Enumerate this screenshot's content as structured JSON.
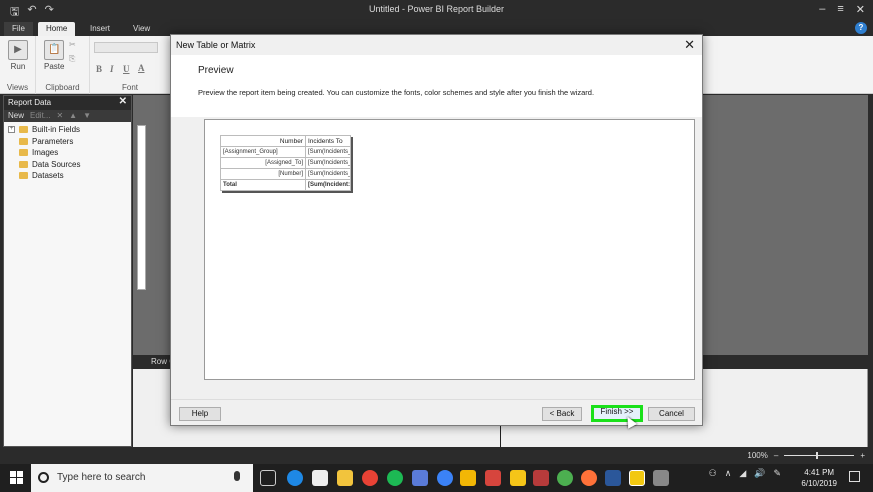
{
  "app": {
    "window_title": "Untitled - Power BI Report Builder",
    "ribbon_tabs": [
      {
        "label": "File"
      },
      {
        "label": "Home"
      },
      {
        "label": "Insert"
      },
      {
        "label": "View"
      }
    ],
    "ribbon": {
      "run_label": "Run",
      "paste_label": "Paste",
      "group_views": "Views",
      "group_clipboard": "Clipboard",
      "group_font": "Font",
      "bold": "B",
      "italic": "I",
      "underline": "U",
      "font_color": "A"
    },
    "help_icon_text": "?"
  },
  "report_data": {
    "title": "Report Data",
    "toolbar": {
      "new_label": "New",
      "edit_label": "Edit..."
    },
    "items": [
      {
        "label": "Built-in Fields"
      },
      {
        "label": "Parameters"
      },
      {
        "label": "Images"
      },
      {
        "label": "Data Sources"
      },
      {
        "label": "Datasets"
      }
    ]
  },
  "design": {
    "row_groups_label": "Row G"
  },
  "dialog": {
    "title": "New Table or Matrix",
    "heading": "Preview",
    "description": "Preview the report item being created. You can customize the fonts, color schemes and style after you finish the wizard.",
    "buttons": {
      "help": "Help",
      "back": "< Back",
      "finish": "Finish >>",
      "cancel": "Cancel"
    },
    "preview_matrix": {
      "header": [
        "Number",
        "Incidents To"
      ],
      "rows": [
        [
          "[Assignment_Group]",
          "[Sum(Incidents_"
        ],
        [
          "[Assigned_To]",
          "[Sum(Incidents_"
        ],
        [
          "[Number]",
          "[Sum(Incidents_"
        ]
      ],
      "total": [
        "Total",
        "[Sum(Incident:"
      ]
    }
  },
  "statusbar": {
    "zoom_label": "100%"
  },
  "taskbar": {
    "search_placeholder": "Type here to search",
    "time": "4:41 PM",
    "date": "6/10/2019"
  },
  "colors": {
    "accent_blue": "#2f7fd0",
    "finish_highlight": "#19e019",
    "dark_chrome": "#2b2b2b"
  }
}
